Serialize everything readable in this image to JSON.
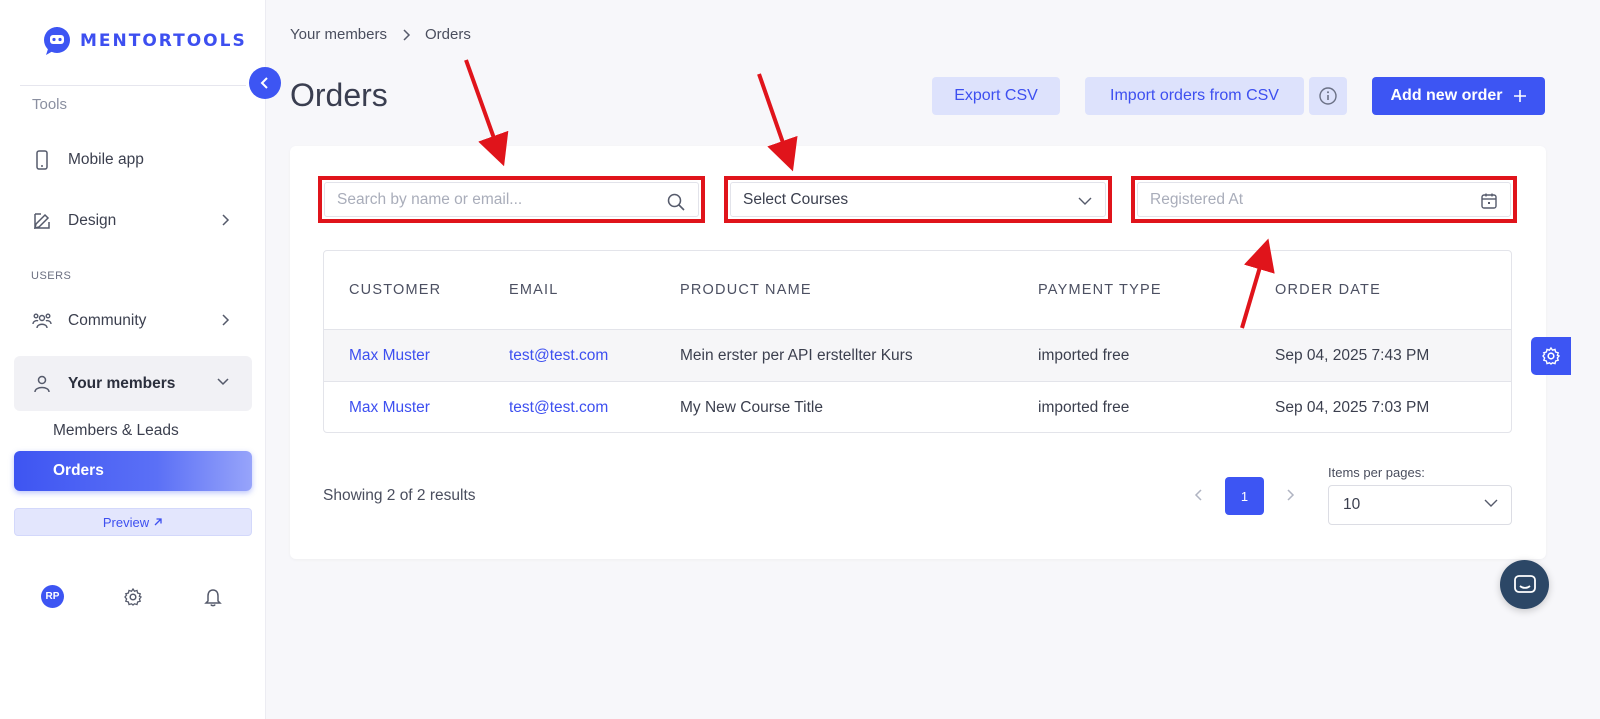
{
  "brand": {
    "name": "MENTORTOOLS",
    "color": "#3d55f3"
  },
  "sidebar": {
    "cut_item": "Tools",
    "items": [
      {
        "label": "Mobile app",
        "icon": "phone-icon"
      },
      {
        "label": "Design",
        "icon": "pencil-icon"
      }
    ],
    "section_users": "USERS",
    "community": "Community",
    "your_members": "Your members",
    "sub_members_leads": "Members & Leads",
    "sub_orders": "Orders",
    "preview": "Preview",
    "avatar_initials": "RP"
  },
  "breadcrumb": {
    "parent": "Your members",
    "current": "Orders"
  },
  "header": {
    "title": "Orders",
    "export_csv": "Export CSV",
    "import_csv": "Import orders from CSV",
    "add_order": "Add new order"
  },
  "filters": {
    "search_placeholder": "Search by name or email...",
    "courses_value": "Select Courses",
    "registered_placeholder": "Registered At"
  },
  "table": {
    "headers": [
      "CUSTOMER",
      "EMAIL",
      "PRODUCT NAME",
      "PAYMENT TYPE",
      "ORDER DATE"
    ],
    "rows": [
      {
        "customer": "Max Muster",
        "email": "test@test.com",
        "product": "Mein erster per API erstellter Kurs",
        "payment": "imported free",
        "date": "Sep 04, 2025 7:43 PM"
      },
      {
        "customer": "Max Muster",
        "email": "test@test.com",
        "product": "My New Course Title",
        "payment": "imported free",
        "date": "Sep 04, 2025 7:03 PM"
      }
    ]
  },
  "pagination": {
    "showing": "Showing 2 of 2 results",
    "current_page": "1",
    "items_per_page_label": "Items per pages:",
    "items_per_page_value": "10"
  },
  "annotation_color": "#e0141b"
}
